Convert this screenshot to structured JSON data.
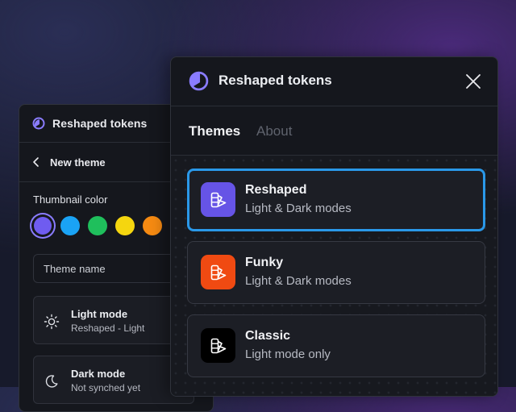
{
  "colors": {
    "accent": "#2a98e8",
    "brand_logo": "#8a7cff",
    "swatches": [
      "#6f5cf0",
      "#1aa3f5",
      "#1fbf5c",
      "#f5d60f",
      "#f58a12"
    ],
    "theme_icons": [
      "#6654e6",
      "#f04a12",
      "#000000"
    ]
  },
  "back_panel": {
    "app_title": "Reshaped tokens",
    "logo_icon": "reshaped-logo-icon",
    "nav": {
      "back_icon": "chevron-left-icon",
      "title": "New theme"
    },
    "thumbnail_label": "Thumbnail color",
    "selected_swatch_index": 0,
    "name_field": {
      "placeholder": "Theme name",
      "value": ""
    },
    "modes": [
      {
        "icon": "sun-icon",
        "title": "Light mode",
        "subtitle": "Reshaped - Light"
      },
      {
        "icon": "moon-icon",
        "title": "Dark mode",
        "subtitle": "Not synched yet"
      }
    ]
  },
  "front_panel": {
    "app_title": "Reshaped tokens",
    "logo_icon": "reshaped-logo-icon",
    "close_icon": "close-icon",
    "tabs": [
      {
        "label": "Themes",
        "active": true
      },
      {
        "label": "About",
        "active": false
      }
    ],
    "themes": [
      {
        "name": "Reshaped",
        "description": "Light & Dark modes",
        "icon": "palette-icon",
        "selected": true
      },
      {
        "name": "Funky",
        "description": "Light & Dark modes",
        "icon": "palette-icon",
        "selected": false
      },
      {
        "name": "Classic",
        "description": "Light mode only",
        "icon": "palette-icon",
        "selected": false
      }
    ]
  }
}
